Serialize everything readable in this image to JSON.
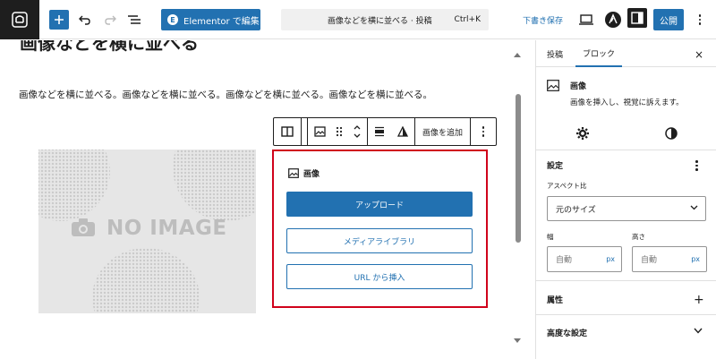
{
  "topbar": {
    "elementor_label": "Elementor で編集",
    "elementor_badge": "E",
    "command_title": "画像などを横に並べる · 投稿",
    "command_shortcut": "Ctrl+K",
    "draft_label": "下書き保存",
    "publish_label": "公開",
    "icons": [
      "wordpress-icon",
      "plus-icon",
      "undo-icon",
      "redo-icon",
      "list-view-icon",
      "preview-icon",
      "astra-icon",
      "settings-icon",
      "more-options-icon"
    ]
  },
  "canvas": {
    "heading": "画像などを横に並べる",
    "paragraph": "画像などを横に並べる。画像などを横に並べる。画像などを横に並べる。画像などを横に並べる。",
    "no_image_text": "NO IMAGE"
  },
  "block_toolbar": {
    "add_image_label": "画像を追加",
    "icons": [
      "columns-icon",
      "image-icon",
      "drag-handle-icon",
      "move-up-down-icon",
      "align-icon",
      "text-color-icon",
      "more-options-icon"
    ]
  },
  "image_block": {
    "label": "画像",
    "upload_label": "アップロード",
    "media_label": "メディアライブラリ",
    "url_label": "URL から挿入"
  },
  "sidebar": {
    "tab_post": "投稿",
    "tab_block": "ブロック",
    "close_label": "×",
    "block_title": "画像",
    "block_desc": "画像を挿入し、視覚に訴えます。",
    "settings_title": "設定",
    "aspect_label": "アスペクト比",
    "aspect_value": "元のサイズ",
    "width_label": "幅",
    "height_label": "高さ",
    "width_value": "自動",
    "height_value": "自動",
    "unit": "px",
    "attributes_title": "属性",
    "advanced_title": "高度な設定",
    "plus_label": "+"
  },
  "colors": {
    "accent": "#2271b1",
    "highlight": "#d0021b",
    "dark": "#1e1e1e"
  }
}
